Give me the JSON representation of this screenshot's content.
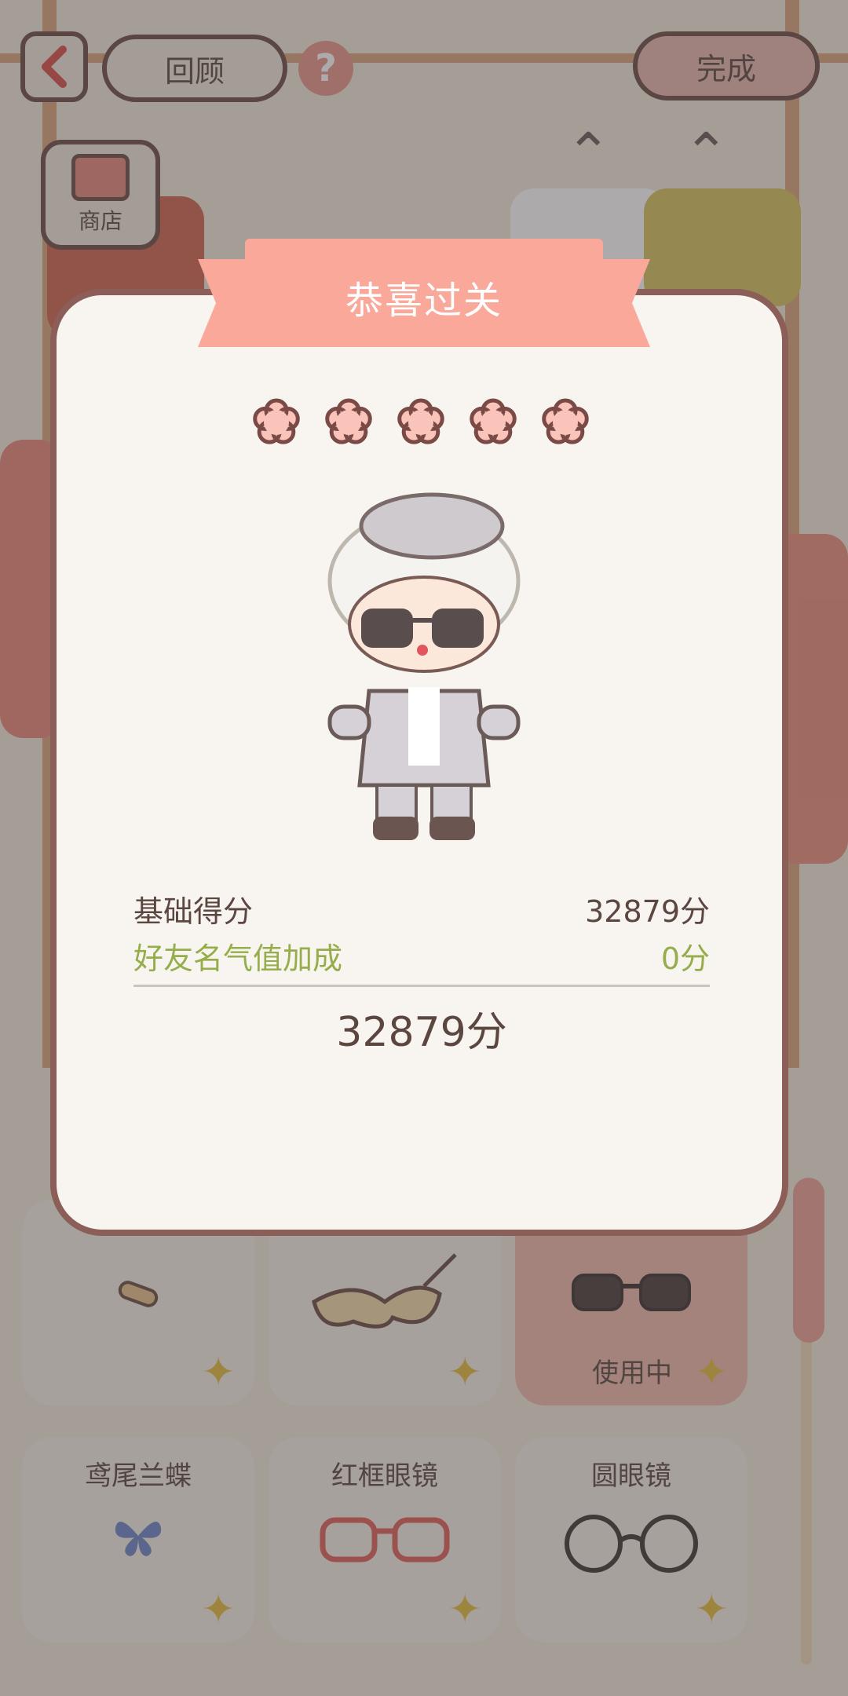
{
  "top_bar": {
    "back_icon": "chevron-left-icon",
    "review_label": "回顾",
    "help_label": "?",
    "done_label": "完成"
  },
  "shop": {
    "label": "商店",
    "icon": "shop-icon"
  },
  "items": [
    {
      "name": "",
      "icon": "bandage-icon",
      "active": false,
      "status": ""
    },
    {
      "name": "",
      "icon": "masquerade-mask-icon",
      "active": false,
      "status": ""
    },
    {
      "name": "",
      "icon": "sunglasses-icon",
      "active": true,
      "status": "使用中"
    },
    {
      "name": "鸢尾兰蝶",
      "icon": "butterfly-icon",
      "active": false,
      "status": ""
    },
    {
      "name": "红框眼镜",
      "icon": "red-glasses-icon",
      "active": false,
      "status": ""
    },
    {
      "name": "圆眼镜",
      "icon": "round-glasses-icon",
      "active": false,
      "status": ""
    }
  ],
  "dialog": {
    "title": "恭喜过关",
    "stars_earned": 5,
    "stars_total": 5,
    "base_score_label": "基础得分",
    "base_score_value": "32879分",
    "bonus_label": "好友名气值加成",
    "bonus_value": "0分",
    "total_value": "32879分"
  },
  "colors": {
    "banner": "#f9a89a",
    "star_fill": "#fbc4bb",
    "star_outline": "#7a4b46",
    "bonus_text": "#95ad4a",
    "dialog_border": "#8b5e58"
  }
}
